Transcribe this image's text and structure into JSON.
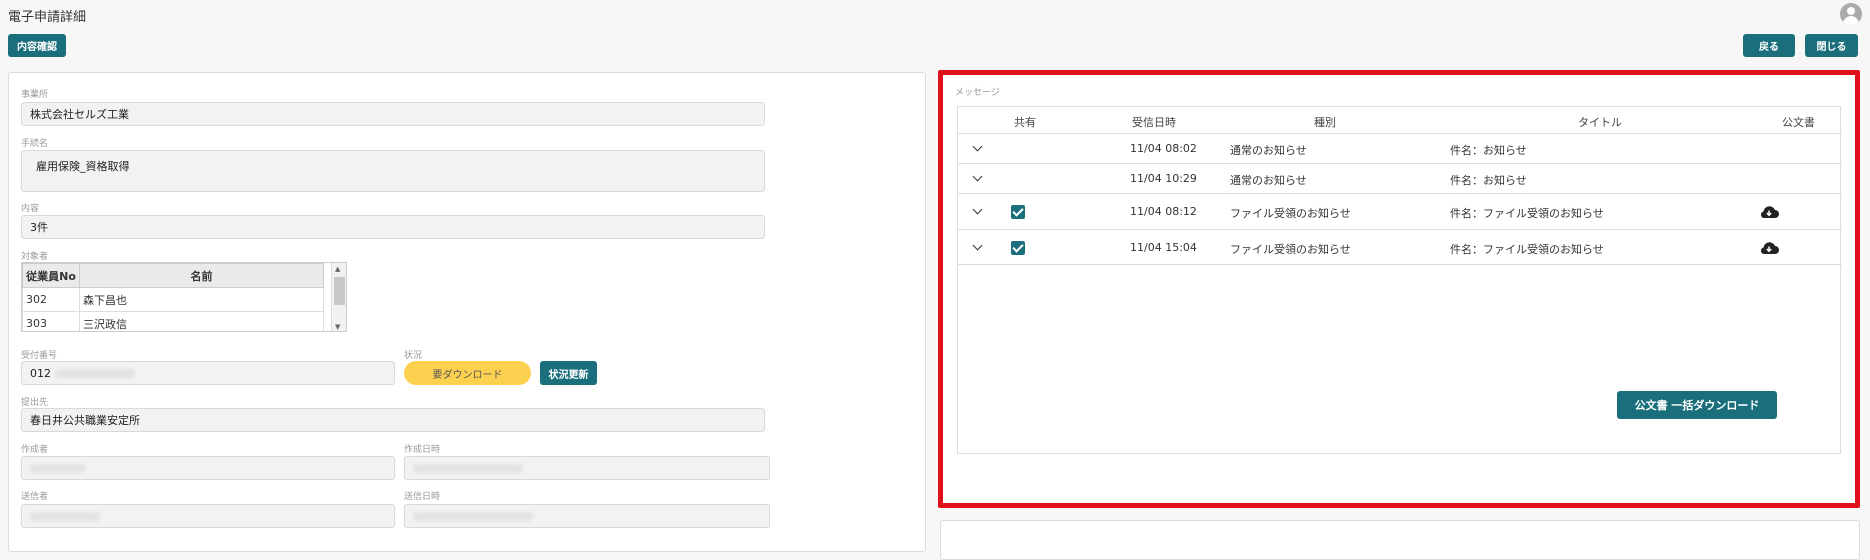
{
  "header": {
    "title": "電子申請詳細",
    "confirm_label": "内容確認",
    "back_label": "戻る",
    "close_label": "閉じる"
  },
  "form": {
    "office_label": "事業所",
    "office_value": "株式会社セルズ工業",
    "procedure_label": "手続名",
    "procedure_value": "雇用保険_資格取得",
    "content_label": "内容",
    "content_value": "3件",
    "subjects_label": "対象者",
    "subjects_columns": [
      "従業員No",
      "名前"
    ],
    "subjects_rows": [
      {
        "no": "302",
        "name": "森下昌也"
      },
      {
        "no": "303",
        "name": "三沢政信"
      }
    ],
    "receipt_label": "受付番号",
    "receipt_value": "012",
    "status_label": "状況",
    "status_value": "要ダウンロード",
    "status_update_label": "状況更新",
    "destination_label": "提出先",
    "destination_value": "春日井公共職業安定所",
    "creator_label": "作成者",
    "created_at_label": "作成日時",
    "sender_label": "送信者",
    "sent_at_label": "送信日時"
  },
  "messages": {
    "label": "メッセージ",
    "columns": [
      "共有",
      "受信日時",
      "種別",
      "タイトル",
      "公文書"
    ],
    "rows": [
      {
        "shared": false,
        "received": "11/04 08:02",
        "type": "通常のお知らせ",
        "title": "件名：お知らせ",
        "document": false
      },
      {
        "shared": false,
        "received": "11/04 10:29",
        "type": "通常のお知らせ",
        "title": "件名：お知らせ",
        "document": false
      },
      {
        "shared": true,
        "received": "11/04 08:12",
        "type": "ファイル受領のお知らせ",
        "title": "件名：ファイル受領のお知らせ",
        "document": true
      },
      {
        "shared": true,
        "received": "11/04 15:04",
        "type": "ファイル受領のお知らせ",
        "title": "件名：ファイル受領のお知らせ",
        "document": true
      }
    ],
    "bulk_download_label": "公文書 一括ダウンロード"
  },
  "icons": {
    "avatar": "user-avatar-icon",
    "expand": "chevron-down-icon",
    "checkbox": "checkbox-checked-icon",
    "download": "cloud-download-icon"
  },
  "colors": {
    "accent": "#1b6f7c",
    "status_pill": "#fdd150",
    "highlight_border": "#e0101a"
  }
}
